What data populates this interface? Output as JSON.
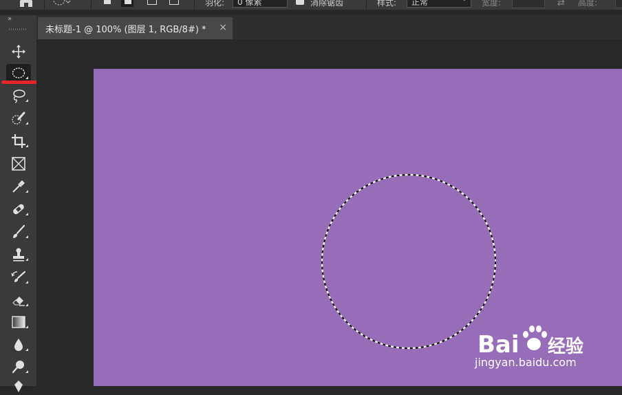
{
  "options_bar": {
    "feather_label": "羽化:",
    "feather_value": "0 像素",
    "antialias_label": "消除锯齿",
    "style_label": "样式:",
    "style_value": "正常",
    "width_label": "宽度:",
    "height_label": "高度:"
  },
  "document": {
    "tab_title": "未标题-1 @ 100% (图层 1, RGB/8#) *",
    "close_glyph": "×",
    "canvas_color": "#956db8"
  },
  "toolbox": {
    "collapse_glyph": "»",
    "tools": [
      {
        "name": "move-tool",
        "icon": "move-icon"
      },
      {
        "name": "elliptical-marquee-tool",
        "icon": "ellipse-marquee-icon",
        "selected": true
      },
      {
        "name": "lasso-tool",
        "icon": "lasso-icon"
      },
      {
        "name": "quick-selection-tool",
        "icon": "quick-selection-icon"
      },
      {
        "name": "crop-tool",
        "icon": "crop-icon"
      },
      {
        "name": "frame-tool",
        "icon": "frame-icon"
      },
      {
        "name": "eyedropper-tool",
        "icon": "eyedropper-icon"
      },
      {
        "name": "healing-brush-tool",
        "icon": "bandage-icon"
      },
      {
        "name": "brush-tool",
        "icon": "brush-icon"
      },
      {
        "name": "clone-stamp-tool",
        "icon": "stamp-icon"
      },
      {
        "name": "history-brush-tool",
        "icon": "history-brush-icon"
      },
      {
        "name": "eraser-tool",
        "icon": "eraser-icon"
      },
      {
        "name": "gradient-tool",
        "icon": "gradient-icon"
      },
      {
        "name": "blur-tool",
        "icon": "blur-drop-icon"
      },
      {
        "name": "dodge-tool",
        "icon": "dodge-icon"
      },
      {
        "name": "pen-tool",
        "icon": "pen-icon"
      }
    ]
  },
  "watermark": {
    "brand": "Bai经验",
    "url": "jingyan.baidu.com"
  },
  "colors": {
    "ui_bg": "#282828",
    "panel": "#3a3a3a",
    "highlight": "#e3242b"
  }
}
